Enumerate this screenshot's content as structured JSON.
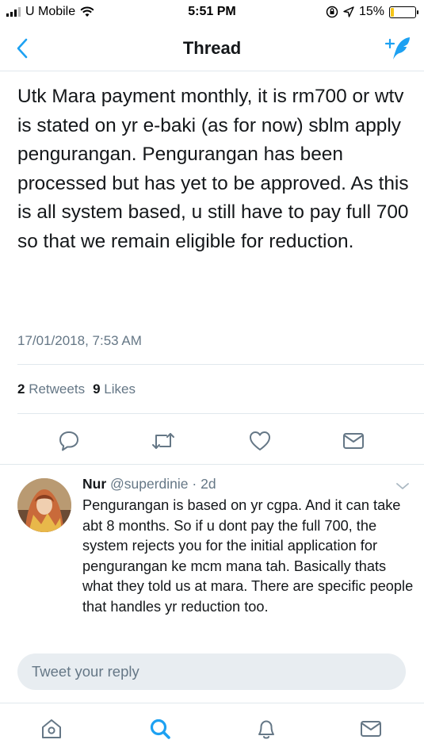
{
  "status_bar": {
    "carrier": "U Mobile",
    "time": "5:51 PM",
    "battery": "15%",
    "battery_level": 0.15
  },
  "nav": {
    "title": "Thread",
    "back_icon": "chevron-left-icon",
    "compose_icon": "compose-tweet-icon"
  },
  "tweet": {
    "text": "Utk Mara payment monthly, it is rm700 or wtv is stated on yr e-baki (as for now) sblm apply pengurangan. Pengurangan has been processed but has yet to be approved. As this is all system based, u still have to pay full 700 so that we remain eligible for reduction.",
    "timestamp": "17/01/2018, 7:53 AM",
    "retweets_count": "2",
    "retweets_label": "Retweets",
    "likes_count": "9",
    "likes_label": "Likes"
  },
  "actions": [
    "reply-icon",
    "retweet-icon",
    "like-icon",
    "share-icon"
  ],
  "reply": {
    "name": "Nur",
    "handle": "@superdinie",
    "separator": "·",
    "age": "2d",
    "text": "Pengurangan is based on yr cgpa. And it can take abt 8 months. So if u dont pay the full 700, the system rejects you for the initial application for pengurangan ke mcm mana tah. Basically thats what they told us at mara. There are specific people that handles yr reduction too."
  },
  "composer": {
    "placeholder": "Tweet your reply"
  },
  "tabs": [
    "home-icon",
    "search-icon",
    "notifications-icon",
    "messages-icon"
  ],
  "colors": {
    "accent": "#1da1f2",
    "icon_gray": "#657786",
    "text": "#14171a",
    "divider": "#e1e8ed",
    "input_bg": "#e8edf1"
  }
}
